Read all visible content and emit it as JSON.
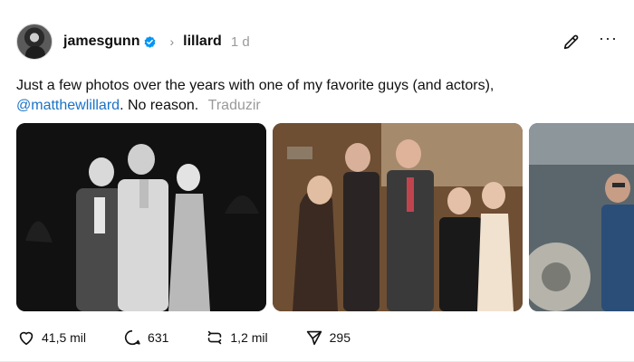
{
  "post": {
    "author": "jamesgunn",
    "repost_user": "lillard",
    "time": "1 d",
    "text_line1": "Just a few photos over the years with one of my favorite guys (and actors),",
    "mention": "@matthewlillard",
    "text_line2": ". No reason.",
    "translate": "Traduzir"
  },
  "actions": {
    "likes": "41,5 mil",
    "replies": "631",
    "reposts": "1,2 mil",
    "shares": "295"
  },
  "colors": {
    "mention": "#1a73c7",
    "verified": "#0095f6",
    "muted": "#9a9a9a"
  }
}
